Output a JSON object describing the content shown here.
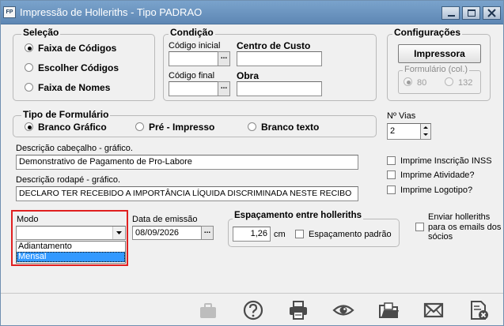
{
  "window": {
    "app_icon": "FP",
    "title": "Impressão de Holleriths  - Tipo PADRAO",
    "controls": [
      "minimize-icon",
      "maximize-icon",
      "close-icon"
    ]
  },
  "selecao": {
    "legend": "Seleção",
    "options": [
      {
        "label": "Faixa de Códigos",
        "selected": true
      },
      {
        "label": "Escolher Códigos",
        "selected": false
      },
      {
        "label": "Faixa de Nomes",
        "selected": false
      }
    ]
  },
  "condicao": {
    "legend": "Condição",
    "codigo_inicial_label": "Código inicial",
    "codigo_inicial_value": "",
    "codigo_final_label": "Código final",
    "codigo_final_value": "",
    "centro_custo_label": "Centro de Custo",
    "centro_custo_value": "",
    "obra_label": "Obra",
    "obra_value": "",
    "lookup_label": "..."
  },
  "configuracoes": {
    "legend": "Configurações",
    "impressora_button": "Impressora",
    "formulario_legend": "Formulário (col.)",
    "options": [
      {
        "label": "80",
        "selected": true
      },
      {
        "label": "132",
        "selected": false
      }
    ]
  },
  "tipo_formulario": {
    "legend": "Tipo de Formulário",
    "options": [
      {
        "label": "Branco Gráfico",
        "selected": true
      },
      {
        "label": "Pré - Impresso",
        "selected": false
      },
      {
        "label": "Branco texto",
        "selected": false
      }
    ]
  },
  "vias": {
    "label": "Nº Vias",
    "value": "2"
  },
  "descricao_cabecalho": {
    "label": "Descrição cabeçalho - gráfico.",
    "value": "Demonstrativo de Pagamento de Pro-Labore"
  },
  "descricao_rodape": {
    "label": "Descrição rodapé - gráfico.",
    "value": "DECLARO TER RECEBIDO A IMPORTÂNCIA LÍQUIDA DISCRIMINADA NESTE RECIBO"
  },
  "checks": [
    {
      "label": "Imprime Inscrição INSS",
      "checked": false
    },
    {
      "label": "Imprime Atividade?",
      "checked": false
    },
    {
      "label": "Imprime Logotipo?",
      "checked": false
    }
  ],
  "modo": {
    "label": "Modo",
    "value": "",
    "options": [
      {
        "label": "Adiantamento",
        "selected": false
      },
      {
        "label": "Mensal",
        "selected": true
      }
    ],
    "highlight_color": "#e02020"
  },
  "data_emissao": {
    "label": "Data de emissão",
    "value": "08/09/2026"
  },
  "espacamento": {
    "legend": "Espaçamento entre holleriths",
    "value": "1,26",
    "unit": "cm",
    "padrao_label": "Espaçamento padrão"
  },
  "enviar_emails": {
    "label": "Enviar holleriths para os emails dos sócios",
    "checked": false
  },
  "toolbar": [
    {
      "icon": "briefcase-icon",
      "enabled": false
    },
    {
      "icon": "help-icon",
      "enabled": true
    },
    {
      "icon": "printer-icon",
      "enabled": true
    },
    {
      "icon": "preview-eye-icon",
      "enabled": true
    },
    {
      "icon": "folder-export-icon",
      "enabled": true
    },
    {
      "icon": "email-icon",
      "enabled": true
    },
    {
      "icon": "close-document-icon",
      "enabled": true
    }
  ]
}
